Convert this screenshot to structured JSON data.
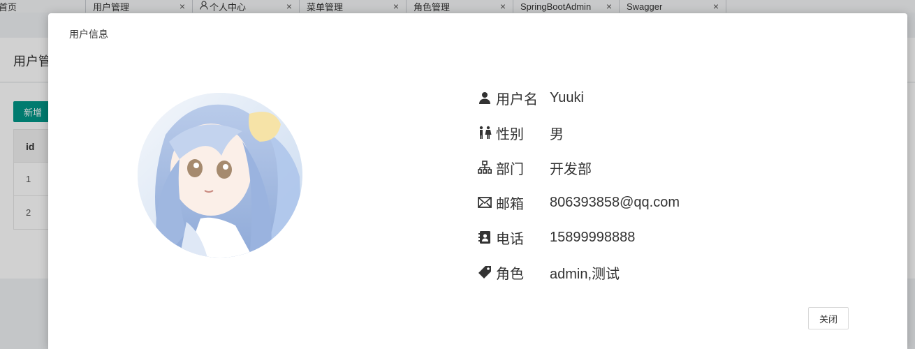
{
  "tabs": [
    {
      "label": "首页",
      "closable": false
    },
    {
      "label": "用户管理",
      "closable": true
    },
    {
      "label": "个人中心",
      "closable": true,
      "icon": "user-icon"
    },
    {
      "label": "菜单管理",
      "closable": true
    },
    {
      "label": "角色管理",
      "closable": true
    },
    {
      "label": "SpringBootAdmin",
      "closable": true
    },
    {
      "label": "Swagger",
      "closable": true
    }
  ],
  "tab_close_glyph": "×",
  "background": {
    "title": "用户管",
    "add_button": "新增",
    "table": {
      "header": "id",
      "rows": [
        "1",
        "2"
      ]
    }
  },
  "dialog": {
    "title": "用户信息",
    "avatar_icon": "anime-avatar-image",
    "fields": [
      {
        "icon": "user-icon",
        "label": "用户名",
        "value": "Yuuki"
      },
      {
        "icon": "gender-icon",
        "label": "性别",
        "value": "男"
      },
      {
        "icon": "sitemap-icon",
        "label": "部门",
        "value": "开发部"
      },
      {
        "icon": "envelope-icon",
        "label": "邮箱",
        "value": "806393858@qq.com"
      },
      {
        "icon": "address-book-icon",
        "label": "电话",
        "value": "15899998888"
      },
      {
        "icon": "tag-icon",
        "label": "角色",
        "value": "admin,测试"
      }
    ],
    "close_button": "关闭"
  },
  "colors": {
    "primary": "#009688",
    "text": "#333333"
  }
}
